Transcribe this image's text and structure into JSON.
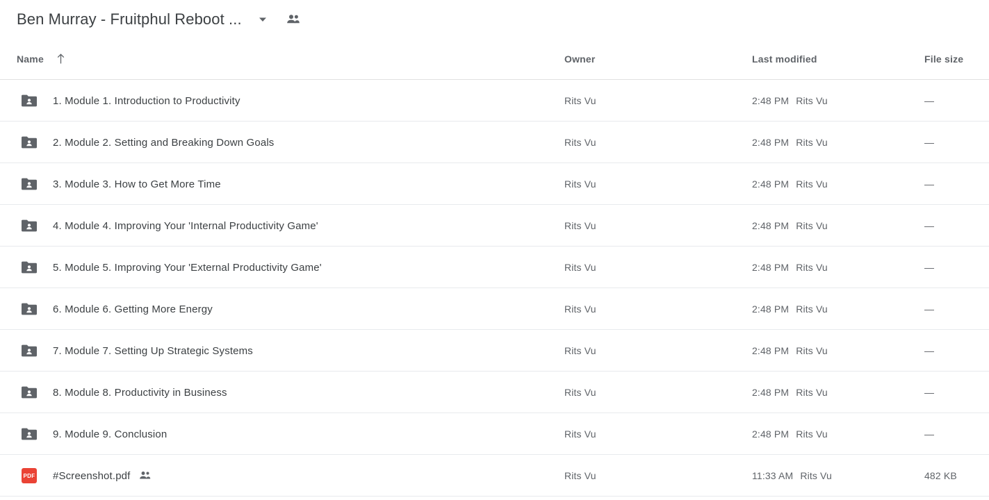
{
  "titlebar": {
    "title": "Ben Murray - Fruitphul Reboot ...",
    "chevron_icon": "chevron-down-icon",
    "shared_icon": "people-shared-icon"
  },
  "colors": {
    "text_primary": "#3c4043",
    "text_secondary": "#5f6368",
    "folder_icon": "#5f6368",
    "pdf_icon": "#ea4335",
    "divider": "#e8eaed"
  },
  "columns": {
    "name": "Name",
    "owner": "Owner",
    "last_modified": "Last modified",
    "file_size": "File size",
    "sort_icon": "arrow-up-icon",
    "sort_direction": "ascending"
  },
  "rows": [
    {
      "icon": "shared-folder-icon",
      "type": "folder",
      "name": "1. Module 1. Introduction to Productivity",
      "owner": "Rits Vu",
      "modified_time": "2:48 PM",
      "modified_by": "Rits Vu",
      "size": "—",
      "shared_badge": false
    },
    {
      "icon": "shared-folder-icon",
      "type": "folder",
      "name": "2. Module 2. Setting and Breaking Down Goals",
      "owner": "Rits Vu",
      "modified_time": "2:48 PM",
      "modified_by": "Rits Vu",
      "size": "—",
      "shared_badge": false
    },
    {
      "icon": "shared-folder-icon",
      "type": "folder",
      "name": "3. Module 3. How to Get More Time",
      "owner": "Rits Vu",
      "modified_time": "2:48 PM",
      "modified_by": "Rits Vu",
      "size": "—",
      "shared_badge": false
    },
    {
      "icon": "shared-folder-icon",
      "type": "folder",
      "name": "4. Module 4. Improving Your 'Internal Productivity Game'",
      "owner": "Rits Vu",
      "modified_time": "2:48 PM",
      "modified_by": "Rits Vu",
      "size": "—",
      "shared_badge": false
    },
    {
      "icon": "shared-folder-icon",
      "type": "folder",
      "name": "5. Module 5. Improving Your 'External Productivity Game'",
      "owner": "Rits Vu",
      "modified_time": "2:48 PM",
      "modified_by": "Rits Vu",
      "size": "—",
      "shared_badge": false
    },
    {
      "icon": "shared-folder-icon",
      "type": "folder",
      "name": "6. Module 6. Getting More Energy",
      "owner": "Rits Vu",
      "modified_time": "2:48 PM",
      "modified_by": "Rits Vu",
      "size": "—",
      "shared_badge": false
    },
    {
      "icon": "shared-folder-icon",
      "type": "folder",
      "name": "7. Module 7. Setting Up Strategic Systems",
      "owner": "Rits Vu",
      "modified_time": "2:48 PM",
      "modified_by": "Rits Vu",
      "size": "—",
      "shared_badge": false
    },
    {
      "icon": "shared-folder-icon",
      "type": "folder",
      "name": "8. Module 8. Productivity in Business",
      "owner": "Rits Vu",
      "modified_time": "2:48 PM",
      "modified_by": "Rits Vu",
      "size": "—",
      "shared_badge": false
    },
    {
      "icon": "shared-folder-icon",
      "type": "folder",
      "name": "9. Module 9. Conclusion",
      "owner": "Rits Vu",
      "modified_time": "2:48 PM",
      "modified_by": "Rits Vu",
      "size": "—",
      "shared_badge": false
    },
    {
      "icon": "pdf-file-icon",
      "icon_label": "PDF",
      "type": "pdf",
      "name": "#Screenshot.pdf",
      "owner": "Rits Vu",
      "modified_time": "11:33 AM",
      "modified_by": "Rits Vu",
      "size": "482 KB",
      "shared_badge": true
    }
  ]
}
